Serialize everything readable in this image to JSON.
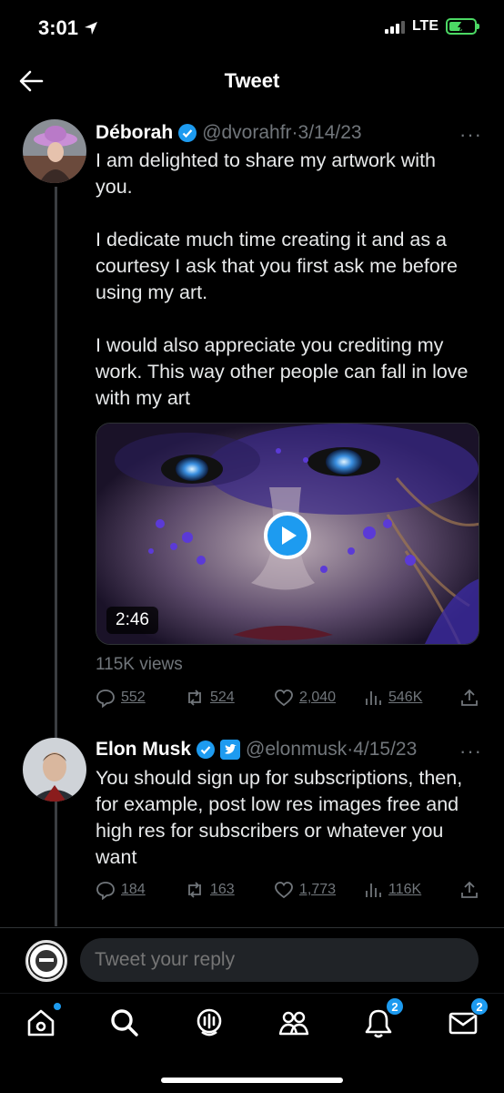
{
  "status_bar": {
    "time": "3:01",
    "network": "LTE"
  },
  "header": {
    "title": "Tweet"
  },
  "tweets": [
    {
      "name": "Déborah",
      "handle": "@dvorahfr",
      "separator": "·",
      "date": "3/14/23",
      "more": "···",
      "body": "I am delighted to share my artwork with you.\n\nI dedicate much time creating it and as a courtesy I ask that you first ask me before using my art.\n\nI would also appreciate you crediting my work. This way other people can fall in love with my art",
      "video_duration": "2:46",
      "views": "115K views",
      "stats": {
        "replies": "552",
        "retweets": "524",
        "likes": "2,040",
        "views": "546K"
      }
    },
    {
      "name": "Elon Musk",
      "handle": "@elonmusk",
      "separator": "·",
      "date": "4/15/23",
      "more": "···",
      "body": "You should sign up for subscriptions, then, for example, post low res images free and high res for subscribers or whatever you want",
      "stats": {
        "replies": "184",
        "retweets": "163",
        "likes": "1,773",
        "views": "116K"
      }
    }
  ],
  "reply": {
    "placeholder": "Tweet your reply"
  },
  "tabs": {
    "notifications_badge": "2",
    "messages_badge": "2"
  },
  "colors": {
    "accent": "#1d9bf0",
    "muted": "#71767b",
    "background": "#000000"
  }
}
